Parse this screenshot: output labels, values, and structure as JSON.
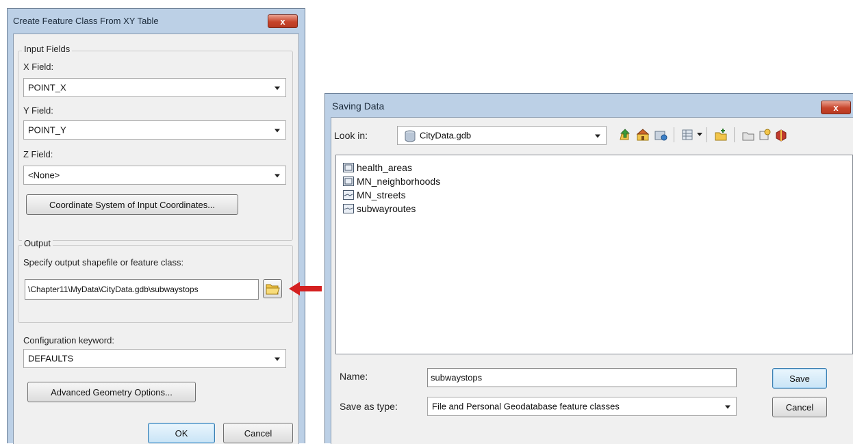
{
  "dialog1": {
    "title": "Create Feature Class From XY Table",
    "input_fields_legend": "Input Fields",
    "x_field": {
      "label": "X Field:",
      "value": "POINT_X"
    },
    "y_field": {
      "label": "Y Field:",
      "value": "POINT_Y"
    },
    "z_field": {
      "label": "Z Field:",
      "value": "<None>"
    },
    "coord_button": "Coordinate System of Input Coordinates...",
    "output_legend": "Output",
    "output_label": "Specify output shapefile or feature class:",
    "output_path": "\\Chapter11\\MyData\\CityData.gdb\\subwaystops",
    "config_label": "Configuration keyword:",
    "config_value": "DEFAULTS",
    "advanced_button": "Advanced Geometry Options...",
    "ok_button": "OK",
    "cancel_button": "Cancel",
    "close_glyph": "x"
  },
  "dialog2": {
    "title": "Saving Data",
    "look_in_label": "Look in:",
    "look_in_value": "CityData.gdb",
    "items": [
      {
        "name": "health_areas",
        "type": "polygon"
      },
      {
        "name": "MN_neighborhoods",
        "type": "polygon"
      },
      {
        "name": "MN_streets",
        "type": "line"
      },
      {
        "name": "subwayroutes",
        "type": "line"
      }
    ],
    "name_label": "Name:",
    "name_value": "subwaystops",
    "type_label": "Save as type:",
    "type_value": "File and Personal Geodatabase feature classes",
    "save_button": "Save",
    "cancel_button": "Cancel",
    "close_glyph": "x"
  },
  "colors": {
    "title_bar": "#bcd0e6",
    "close_button": "#c7442b",
    "arrow": "#d42020",
    "folder": "#f2c54a"
  }
}
